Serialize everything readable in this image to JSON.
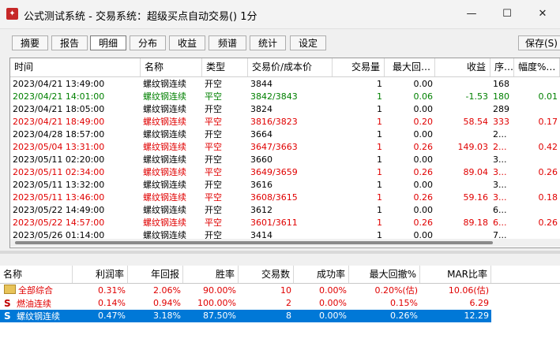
{
  "window": {
    "title": "公式测试系统 - 交易系统：超级买点自动交易() 1分",
    "minimize_icon": "minimize-icon",
    "maximize_icon": "maximize-icon",
    "close_icon": "close-icon"
  },
  "tabs": [
    "摘要",
    "报告",
    "明细",
    "分布",
    "收益",
    "频谱",
    "统计",
    "设定"
  ],
  "active_tab": "明细",
  "save_button": "保存(S)",
  "colors": {
    "red": "#e00000",
    "green": "#008000",
    "black": "#000000",
    "selection": "#0078d7"
  },
  "detail": {
    "columns": [
      "时间",
      "名称",
      "类型",
      "交易价/成本价",
      "交易量",
      "最大回…",
      "收益",
      "序…",
      "幅度%…"
    ],
    "rows": [
      {
        "time": "2023/04/21 13:49:00",
        "name": "螺纹钢连续",
        "type": "开空",
        "price": "3844",
        "qty": "1",
        "dd": "0.00",
        "profit": "",
        "seq": "168",
        "range": "",
        "color": "black"
      },
      {
        "time": "2023/04/21 14:01:00",
        "name": "螺纹钢连续",
        "type": "平空",
        "price": "3842/3843",
        "qty": "1",
        "dd": "0.06",
        "profit": "-1.53",
        "seq": "180",
        "range": "0.01",
        "color": "green"
      },
      {
        "time": "2023/04/21 18:05:00",
        "name": "螺纹钢连续",
        "type": "开空",
        "price": "3824",
        "qty": "1",
        "dd": "0.00",
        "profit": "",
        "seq": "289",
        "range": "",
        "color": "black"
      },
      {
        "time": "2023/04/21 18:49:00",
        "name": "螺纹钢连续",
        "type": "平空",
        "price": "3816/3823",
        "qty": "1",
        "dd": "0.20",
        "profit": "58.54",
        "seq": "333",
        "range": "0.17",
        "color": "red"
      },
      {
        "time": "2023/04/28 18:57:00",
        "name": "螺纹钢连续",
        "type": "开空",
        "price": "3664",
        "qty": "1",
        "dd": "0.00",
        "profit": "",
        "seq": "2...",
        "range": "",
        "color": "black"
      },
      {
        "time": "2023/05/04 13:31:00",
        "name": "螺纹钢连续",
        "type": "平空",
        "price": "3647/3663",
        "qty": "1",
        "dd": "0.26",
        "profit": "149.03",
        "seq": "2...",
        "range": "0.42",
        "color": "red"
      },
      {
        "time": "2023/05/11 02:20:00",
        "name": "螺纹钢连续",
        "type": "开空",
        "price": "3660",
        "qty": "1",
        "dd": "0.00",
        "profit": "",
        "seq": "3...",
        "range": "",
        "color": "black"
      },
      {
        "time": "2023/05/11 02:34:00",
        "name": "螺纹钢连续",
        "type": "平空",
        "price": "3649/3659",
        "qty": "1",
        "dd": "0.26",
        "profit": "89.04",
        "seq": "3...",
        "range": "0.26",
        "color": "red"
      },
      {
        "time": "2023/05/11 13:32:00",
        "name": "螺纹钢连续",
        "type": "开空",
        "price": "3616",
        "qty": "1",
        "dd": "0.00",
        "profit": "",
        "seq": "3...",
        "range": "",
        "color": "black"
      },
      {
        "time": "2023/05/11 13:46:00",
        "name": "螺纹钢连续",
        "type": "平空",
        "price": "3608/3615",
        "qty": "1",
        "dd": "0.26",
        "profit": "59.16",
        "seq": "3...",
        "range": "0.18",
        "color": "red"
      },
      {
        "time": "2023/05/22 14:49:00",
        "name": "螺纹钢连续",
        "type": "开空",
        "price": "3612",
        "qty": "1",
        "dd": "0.00",
        "profit": "",
        "seq": "6...",
        "range": "",
        "color": "black"
      },
      {
        "time": "2023/05/22 14:57:00",
        "name": "螺纹钢连续",
        "type": "平空",
        "price": "3601/3611",
        "qty": "1",
        "dd": "0.26",
        "profit": "89.18",
        "seq": "6...",
        "range": "0.26",
        "color": "red"
      },
      {
        "time": "2023/05/26 01:14:00",
        "name": "螺纹钢连续",
        "type": "开空",
        "price": "3414",
        "qty": "1",
        "dd": "0.00",
        "profit": "",
        "seq": "7...",
        "range": "",
        "color": "black"
      }
    ]
  },
  "summary": {
    "columns": [
      "名称",
      "利润率",
      "年回报",
      "胜率",
      "交易数",
      "成功率",
      "最大回撤%",
      "MAR比率"
    ],
    "rows": [
      {
        "icon": "folder-icon",
        "name": "全部综合",
        "profit_rate": "0.31%",
        "annual": "2.06%",
        "win": "90.00%",
        "trades": "10",
        "success": "0.00%",
        "maxdd": "0.20%(估)",
        "mar": "10.06(估)",
        "selected": false
      },
      {
        "icon": "s-icon",
        "icon_text": "S",
        "name": "燃油连续",
        "profit_rate": "0.14%",
        "annual": "0.94%",
        "win": "100.00%",
        "trades": "2",
        "success": "0.00%",
        "maxdd": "0.15%",
        "mar": "6.29",
        "selected": false
      },
      {
        "icon": "s-icon",
        "icon_text": "S",
        "name": "螺纹钢连续",
        "profit_rate": "0.47%",
        "annual": "3.18%",
        "win": "87.50%",
        "trades": "8",
        "success": "0.00%",
        "maxdd": "0.26%",
        "mar": "12.29",
        "selected": true
      }
    ]
  }
}
